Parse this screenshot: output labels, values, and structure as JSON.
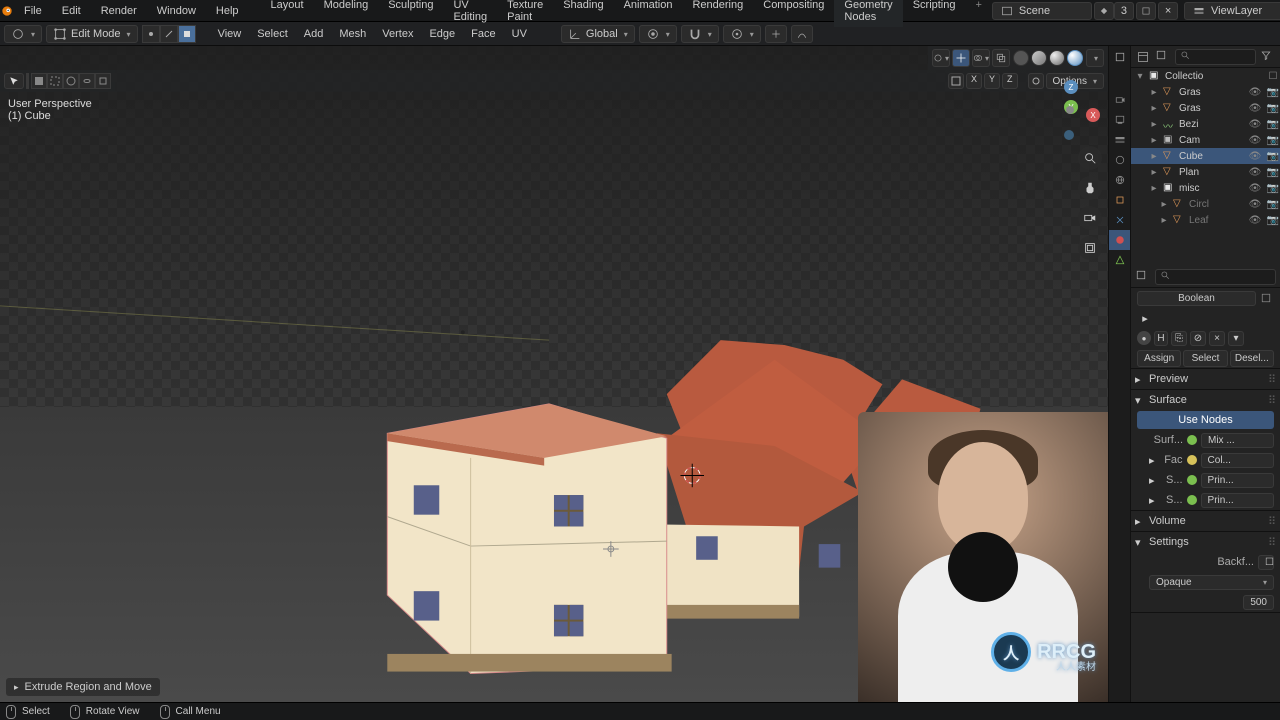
{
  "top_menu": {
    "file": "File",
    "edit": "Edit",
    "render": "Render",
    "window": "Window",
    "help": "Help"
  },
  "workspaces": [
    "Layout",
    "Modeling",
    "Sculpting",
    "UV Editing",
    "Texture Paint",
    "Shading",
    "Animation",
    "Rendering",
    "Compositing",
    "Geometry Nodes",
    "Scripting"
  ],
  "active_workspace": 9,
  "scene_field": "Scene",
  "scene_users": "3",
  "viewlayer_field": "ViewLayer",
  "toolbar": {
    "mode": "Edit Mode",
    "menus": {
      "view": "View",
      "select": "Select",
      "add": "Add",
      "mesh": "Mesh",
      "vertex": "Vertex",
      "edge": "Edge",
      "face": "Face",
      "uv": "UV"
    },
    "orientation": "Global",
    "overlay_xyz": [
      "X",
      "Y",
      "Z"
    ],
    "options": "Options"
  },
  "view_info": {
    "l1": "User Perspective",
    "l2": "(1) Cube"
  },
  "gizmo": {
    "x": "X",
    "y": "Y",
    "z": "Z"
  },
  "last_op": "Extrude Region and Move",
  "statusbar": {
    "select": "Select",
    "rotate": "Rotate View",
    "menu": "Call Menu"
  },
  "outliner": {
    "root": "Collectio",
    "items": [
      {
        "name": "Gras",
        "type": "mesh",
        "depth": 1
      },
      {
        "name": "Gras",
        "type": "mesh",
        "depth": 1
      },
      {
        "name": "Bezi",
        "type": "curve",
        "depth": 1
      },
      {
        "name": "Cam",
        "type": "cam",
        "depth": 1
      },
      {
        "name": "Cube",
        "type": "mesh",
        "depth": 1,
        "selected": true
      },
      {
        "name": "Plan",
        "type": "mesh",
        "depth": 1
      },
      {
        "name": "misc",
        "type": "coll",
        "depth": 1
      },
      {
        "name": "Circl",
        "type": "mesh",
        "depth": 2,
        "muted": true
      },
      {
        "name": "Leaf",
        "type": "mesh",
        "depth": 2,
        "muted": true
      }
    ]
  },
  "properties": {
    "header_field": "Boolean",
    "slot_letter": "H",
    "vertex_groups": {
      "assign": "Assign",
      "select": "Select",
      "deselect": "Desel..."
    },
    "preview": "Preview",
    "surface": "Surface",
    "use_nodes": "Use Nodes",
    "row_surface": {
      "label": "Surf...",
      "value": "Mix ..."
    },
    "row_fac": {
      "label": "Fac",
      "value": "Col..."
    },
    "row_s1": {
      "label": "S...",
      "value": "Prin..."
    },
    "row_s2": {
      "label": "S...",
      "value": "Prin..."
    },
    "volume": "Volume",
    "settings": "Settings",
    "backface": "Backf...",
    "blend": "Opaque",
    "num_500": "500"
  },
  "watermark": {
    "main": "RRCG",
    "sub": "人人素材"
  }
}
